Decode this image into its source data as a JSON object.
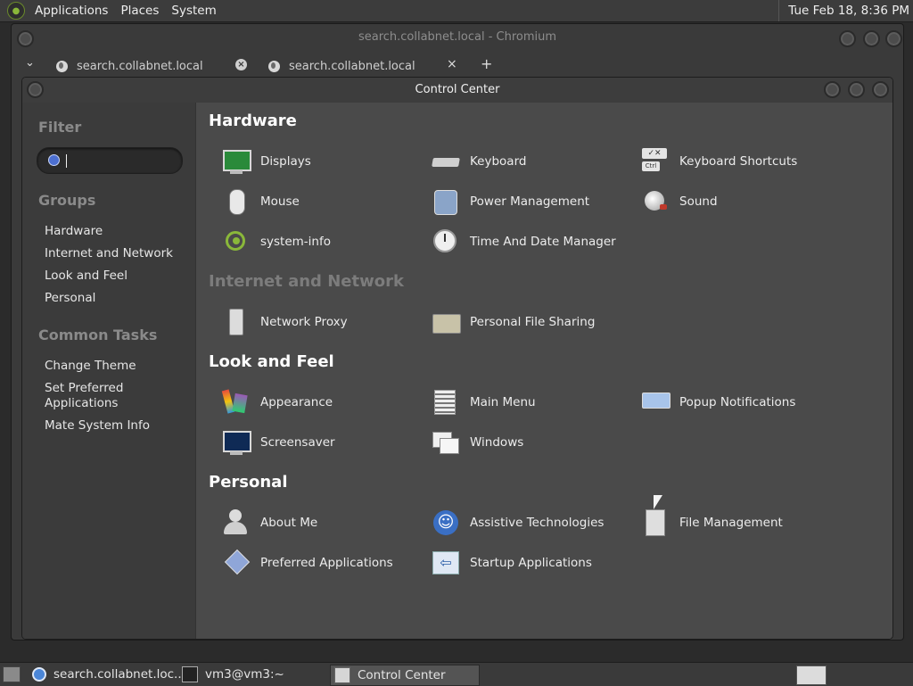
{
  "top_panel": {
    "menus": [
      "Applications",
      "Places",
      "System"
    ],
    "clock": "Tue Feb 18,  8:36 PM"
  },
  "chromium": {
    "title": "search.collabnet.local - Chromium",
    "tabs": [
      {
        "title": "search.collabnet.local",
        "close": "×"
      },
      {
        "title": "search.collabnet.local",
        "close": "×"
      }
    ],
    "tab_list_glyph": "⌄",
    "new_tab_glyph": "+"
  },
  "control_center": {
    "title": "Control Center",
    "sidebar": {
      "filter_heading": "Filter",
      "search_value": "",
      "groups_heading": "Groups",
      "groups": [
        "Hardware",
        "Internet and Network",
        "Look and Feel",
        "Personal"
      ],
      "tasks_heading": "Common Tasks",
      "tasks": [
        "Change Theme",
        "Set Preferred Applications",
        "Mate System Info"
      ]
    },
    "sections": {
      "hardware": {
        "title": "Hardware",
        "items": [
          {
            "label": "Displays",
            "icon": "display-icon"
          },
          {
            "label": "Keyboard",
            "icon": "keyboard-icon"
          },
          {
            "label": "Keyboard Shortcuts",
            "icon": "keyboard-shortcuts-icon"
          },
          {
            "label": "Mouse",
            "icon": "mouse-icon"
          },
          {
            "label": "Power Management",
            "icon": "power-icon"
          },
          {
            "label": "Sound",
            "icon": "sound-icon"
          },
          {
            "label": "system-info",
            "icon": "system-info-icon"
          },
          {
            "label": "Time And Date Manager",
            "icon": "clock-icon"
          }
        ]
      },
      "internet": {
        "title": "Internet and Network",
        "items": [
          {
            "label": "Network Proxy",
            "icon": "network-proxy-icon"
          },
          {
            "label": "Personal File Sharing",
            "icon": "folder-icon"
          }
        ]
      },
      "look": {
        "title": "Look and Feel",
        "items": [
          {
            "label": "Appearance",
            "icon": "appearance-icon"
          },
          {
            "label": "Main Menu",
            "icon": "main-menu-icon"
          },
          {
            "label": "Popup Notifications",
            "icon": "popup-icon"
          },
          {
            "label": "Screensaver",
            "icon": "screensaver-icon"
          },
          {
            "label": "Windows",
            "icon": "windows-icon"
          }
        ]
      },
      "personal": {
        "title": "Personal",
        "items": [
          {
            "label": "About Me",
            "icon": "about-me-icon"
          },
          {
            "label": "Assistive Technologies",
            "icon": "accessibility-icon"
          },
          {
            "label": "File Management",
            "icon": "file-management-icon"
          },
          {
            "label": "Preferred Applications",
            "icon": "preferred-apps-icon"
          },
          {
            "label": "Startup Applications",
            "icon": "startup-apps-icon"
          }
        ]
      }
    }
  },
  "taskbar": {
    "tasks": [
      {
        "label": "search.collabnet.loc...",
        "icon": "chromium-icon"
      },
      {
        "label": "vm3@vm3:~",
        "icon": "terminal-icon"
      },
      {
        "label": "Control Center",
        "icon": "control-center-icon"
      }
    ]
  },
  "colors": {
    "panel": "#3c3c3c",
    "window_bg": "#4a4a4a",
    "sidebar_bg": "#3b3b3b",
    "heading_dim": "#7c7c7c"
  }
}
